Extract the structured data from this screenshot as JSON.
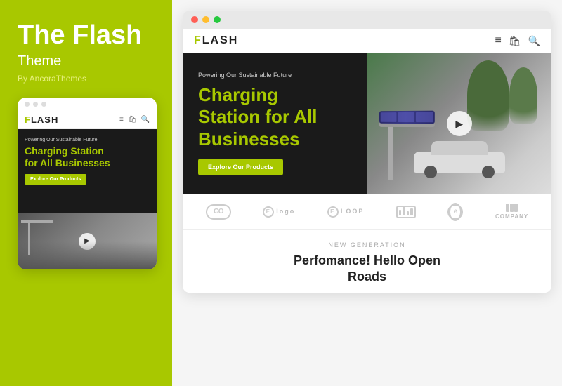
{
  "left": {
    "title": "The Flash",
    "subtitle": "Theme",
    "by": "By AncoraThemes",
    "mobile": {
      "nav_logo": "FLASH",
      "hero_eyebrow": "Powering Our Sustainable Future",
      "hero_title_lime": "Charging Station",
      "hero_title_white": "for All Businesses",
      "hero_btn": "Explore Our Products"
    }
  },
  "right": {
    "nav_logo": "FLASH",
    "hero_eyebrow": "Powering Our Sustainable Future",
    "hero_title_lime": "Charging",
    "hero_title_lime2": "Station",
    "hero_title_white": "for All",
    "hero_title_white2": "Businesses",
    "hero_btn": "Explore Our Products",
    "logos": [
      {
        "id": "go",
        "type": "go",
        "label": ""
      },
      {
        "id": "elogo",
        "type": "elogo",
        "label": "Elogo"
      },
      {
        "id": "eloop",
        "type": "eloop",
        "label": "ELOOP"
      },
      {
        "id": "bars",
        "type": "bars",
        "label": ""
      },
      {
        "id": "e2",
        "type": "e2",
        "label": ""
      },
      {
        "id": "company",
        "type": "company",
        "label": "COMPANY"
      }
    ],
    "new_gen_label": "NEW GENERATION",
    "new_gen_title_line1": "Perfomance! Hello Open",
    "new_gen_title_line2": "Roads"
  }
}
